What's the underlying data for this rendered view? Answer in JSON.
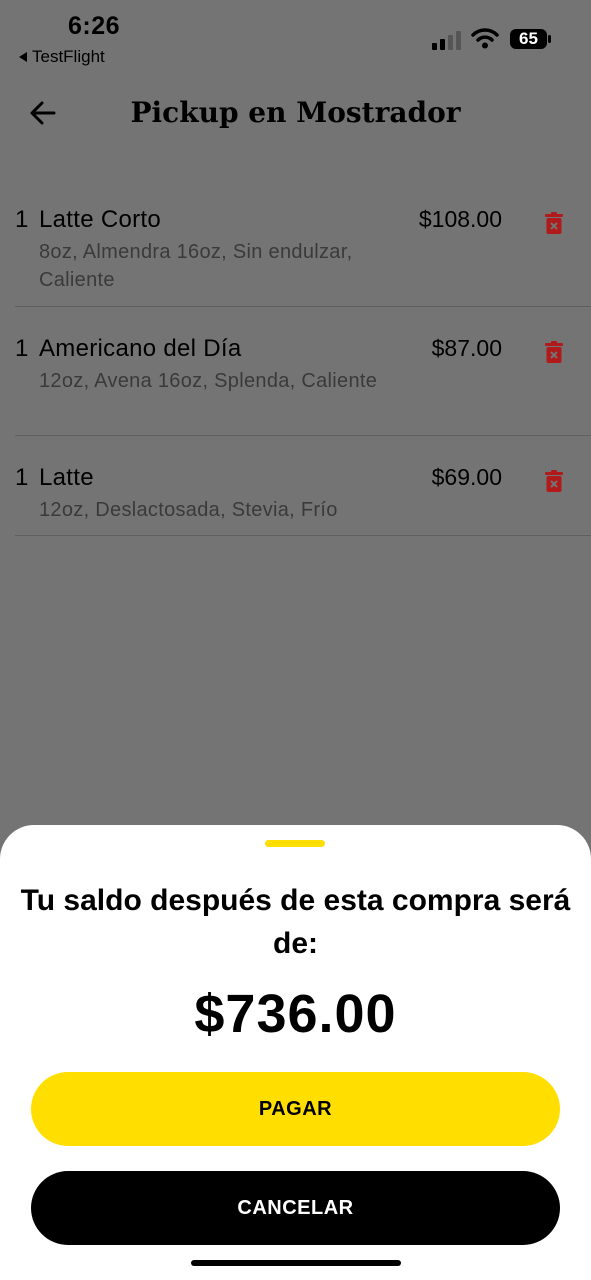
{
  "status_bar": {
    "time": "6:26",
    "back_app": "TestFlight",
    "battery": "65"
  },
  "header": {
    "title": "Pickup en Mostrador",
    "back_icon": "arrow-left-icon"
  },
  "order": {
    "items": [
      {
        "qty": "1",
        "name": "Latte Corto",
        "details": "8oz, Almendra 16oz, Sin endulzar, Caliente",
        "price": "$108.00"
      },
      {
        "qty": "1",
        "name": "Americano del Día",
        "details": "12oz, Avena 16oz, Splenda, Caliente",
        "price": "$87.00"
      },
      {
        "qty": "1",
        "name": "Latte",
        "details": "12oz, Deslactosada, Stevia, Frío",
        "price": "$69.00"
      }
    ]
  },
  "sheet": {
    "title": "Tu saldo después de esta compra será de:",
    "balance": "$736.00",
    "pay_label": "PAGAR",
    "cancel_label": "CANCELAR"
  },
  "colors": {
    "accent": "#ffde00",
    "trash": "#b01a1a",
    "overlay_bg": "#747474"
  }
}
